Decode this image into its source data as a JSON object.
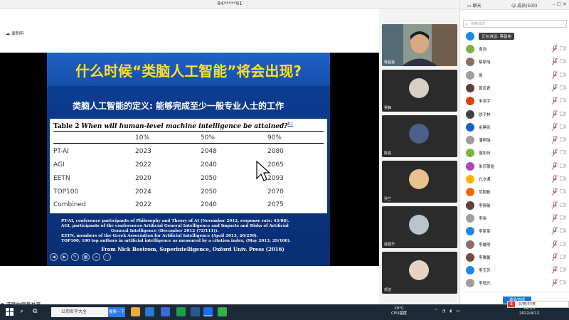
{
  "titlebar": {
    "meeting_id": "84*****81"
  },
  "recording": {
    "label": "录制中"
  },
  "slide": {
    "headline": "什么时候“类脑人工智能”将会出现?",
    "definition": "类脑人工智能的定义: 能够完成至少一般专业人士的工作",
    "table": {
      "caption_prefix": "Table 2",
      "caption_title": "When will human-level machine intelligence be attained?",
      "caption_ref": "81",
      "headers": [
        "",
        "10%",
        "50%",
        "90%"
      ],
      "rows": [
        [
          "PT-AI",
          "2023",
          "2048",
          "2080"
        ],
        [
          "AGI",
          "2022",
          "2040",
          "2065"
        ],
        [
          "EETN",
          "2020",
          "2050",
          "2093"
        ],
        [
          "TOP100",
          "2024",
          "2050",
          "2070"
        ],
        [
          "Combined",
          "2022",
          "2040",
          "2075"
        ]
      ]
    },
    "notes": [
      "PT-AI, conference participants of Philosophy and Theory of AI (November 2012, response rate: 43/88).",
      "AGI, participants of the conferences Artificial General Intelligence and Impacts and Risks of Artificial",
      "General Intelligence (December 2012 (72/111)).",
      "EETN, members of the Greek Association for Artificial Intelligence (April 2013, 26/250).",
      "TOP100, 100 top authors in artificial intelligence as measured by a citation index, (May 2013, 29/100)."
    ],
    "source": "From Nick Bostrom, Superintelligence, Oxford Univ. Press (2016)"
  },
  "share_status": "满屏的屏幕共享",
  "videos": [
    {
      "name": "蒋昌裕",
      "color": "#6b7a60"
    },
    {
      "name": "吴静",
      "color": "#3a3a3a"
    },
    {
      "name": "陈悦",
      "color": "#2f3f5c"
    },
    {
      "name": "孙兰",
      "color": "#3d3d3d"
    },
    {
      "name": "成建华",
      "color": "#3a3a3a"
    },
    {
      "name": "邓洁",
      "color": "#3d3d3d"
    }
  ],
  "panel": {
    "tab_chat": "聊天",
    "tab_members": "成员(500)",
    "search_placeholder": "搜索成员",
    "speaking": "正在讲话: 蒋昌裕",
    "members": [
      {
        "name": "谢浩",
        "color": "#7cb342"
      },
      {
        "name": "蔡家瑞",
        "color": "#8d6e63"
      },
      {
        "name": "周",
        "color": "#9e9e9e"
      },
      {
        "name": "黄亚君",
        "color": "#5d4037"
      },
      {
        "name": "朱泽宇",
        "color": "#d84315"
      },
      {
        "name": "欧子林",
        "color": "#424242"
      },
      {
        "name": "金建民",
        "color": "#1565c0"
      },
      {
        "name": "潘明瑞",
        "color": "#9e9e9e"
      },
      {
        "name": "唐加伟",
        "color": "#7cb342"
      },
      {
        "name": "朱莎蕾姐",
        "color": "#ab47bc"
      },
      {
        "name": "孔令通",
        "color": "#ffb300"
      },
      {
        "name": "范刚勤",
        "color": "#ef6c00"
      },
      {
        "name": "李倩敏",
        "color": "#5d4037"
      },
      {
        "name": "李晓",
        "color": "#9e9e9e"
      },
      {
        "name": "李家豪",
        "color": "#1e88e5"
      },
      {
        "name": "李耀明",
        "color": "#8d6e63"
      },
      {
        "name": "李雅馨",
        "color": "#6d4c41"
      },
      {
        "name": "李玉芳",
        "color": "#1e88e5"
      },
      {
        "name": "李增光",
        "color": "#9e9e9e"
      }
    ],
    "invite_label": "邀请/管理"
  },
  "taskbar": {
    "search_text": "公司名字大全",
    "search_button": "搜索一下",
    "weather_temp": "29°C",
    "weather_label": "CPU温度",
    "time": "14:23",
    "date": "2022/4/12",
    "ime_text": "汉/英/中/英"
  }
}
